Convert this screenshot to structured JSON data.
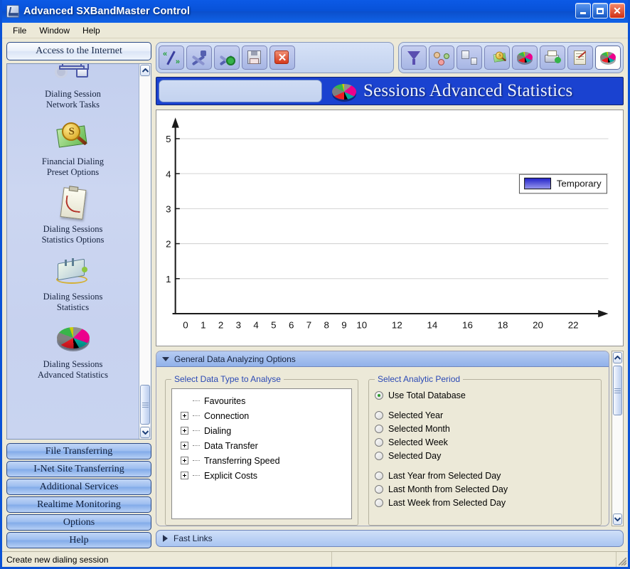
{
  "window": {
    "title": "Advanced SXBandMaster Control",
    "icon": "app-icon",
    "controls": {
      "minimize": "_",
      "maximize": "□",
      "close": "×"
    }
  },
  "menu": {
    "items": [
      "File",
      "Window",
      "Help"
    ]
  },
  "sidebar": {
    "access_button": "Access to the Internet",
    "items": [
      {
        "label_line1": "Dialing Session",
        "label_line2": "Network Tasks",
        "icon": "network-computers-icon"
      },
      {
        "label_line1": "Financial Dialing",
        "label_line2": "Preset Options",
        "icon": "money-magnifier-icon"
      },
      {
        "label_line1": "Dialing Sessions",
        "label_line2": "Statistics Options",
        "icon": "clipboard-chart-icon"
      },
      {
        "label_line1": "Dialing Sessions",
        "label_line2": "Statistics",
        "icon": "statistics-device-icon"
      },
      {
        "label_line1": "Dialing Sessions",
        "label_line2": "Advanced Statistics",
        "icon": "pie-chart-icon"
      }
    ],
    "buttons": [
      "File Transferring",
      "I-Net Site Transferring",
      "Additional Services",
      "Realtime Monitoring",
      "Options",
      "Help"
    ],
    "scrollbar": {
      "up": "scroll-up-arrow",
      "down": "scroll-down-arrow"
    }
  },
  "toolbar_left": [
    {
      "name": "quick-navigate-button",
      "icon": "double-arrow-icon"
    },
    {
      "name": "tools-button",
      "icon": "hammer-wrench-icon"
    },
    {
      "name": "settings-button",
      "icon": "tools-gear-icon"
    },
    {
      "name": "save-button",
      "icon": "floppy-disk-icon"
    },
    {
      "name": "close-button",
      "icon": "red-x-icon"
    }
  ],
  "toolbar_right": [
    {
      "name": "filter-button",
      "icon": "funnel-icon",
      "selected": false
    },
    {
      "name": "accounts-button",
      "icon": "people-icon",
      "selected": false
    },
    {
      "name": "devices-button",
      "icon": "devices-icon",
      "selected": false
    },
    {
      "name": "financial-button",
      "icon": "money-magnifier-icon",
      "selected": false
    },
    {
      "name": "statistics-button",
      "icon": "pie-chart-icon",
      "selected": false
    },
    {
      "name": "reports-button",
      "icon": "printer-icon",
      "selected": false
    },
    {
      "name": "notes-button",
      "icon": "note-pen-icon",
      "selected": false
    },
    {
      "name": "advanced-statistics-button",
      "icon": "pie-chart-icon",
      "selected": true
    }
  ],
  "banner": {
    "input_value": "",
    "input_placeholder": "",
    "icon": "pie-chart-icon",
    "title": "Sessions Advanced Statistics"
  },
  "chart_data": {
    "type": "bar",
    "title": "",
    "xlabel": "",
    "ylabel": "",
    "x_ticks": [
      "0",
      "1",
      "2",
      "3",
      "4",
      "5",
      "6",
      "7",
      "8",
      "9",
      "10",
      "12",
      "14",
      "16",
      "18",
      "20",
      "22"
    ],
    "y_ticks": [
      "1",
      "2",
      "3",
      "4",
      "5"
    ],
    "xlim": [
      0,
      23
    ],
    "ylim": [
      0,
      5.6
    ],
    "grid": true,
    "categories": [
      "0",
      "1",
      "2",
      "3",
      "4",
      "5",
      "6",
      "7",
      "8",
      "9",
      "10",
      "12",
      "14",
      "16",
      "18",
      "20",
      "22"
    ],
    "values": [
      0,
      0,
      0,
      0,
      0,
      0,
      0,
      0,
      0,
      0,
      0,
      0,
      0,
      0,
      0,
      0,
      0
    ],
    "series": [
      {
        "name": "Temporary",
        "color": "#3b3bdb",
        "values": [
          0,
          0,
          0,
          0,
          0,
          0,
          0,
          0,
          0,
          0,
          0,
          0,
          0,
          0,
          0,
          0,
          0
        ]
      }
    ],
    "legend": {
      "position": "right",
      "entries": [
        {
          "label": "Temporary",
          "color": "#3b3bdb"
        }
      ]
    }
  },
  "options_panel": {
    "header": "General Data Analyzing Options",
    "header_state": "expanded",
    "data_type_group": {
      "legend": "Select Data Type to Analyse",
      "items": [
        {
          "label": "Favourites",
          "expandable": false
        },
        {
          "label": "Connection",
          "expandable": true
        },
        {
          "label": "Dialing",
          "expandable": true
        },
        {
          "label": "Data Transfer",
          "expandable": true
        },
        {
          "label": "Transferring Speed",
          "expandable": true
        },
        {
          "label": "Explicit Costs",
          "expandable": true
        }
      ]
    },
    "period_group": {
      "legend": "Select Analytic Period",
      "options": [
        {
          "label": "Use Total Database",
          "selected": true,
          "gap_after": true
        },
        {
          "label": "Selected Year",
          "selected": false
        },
        {
          "label": "Selected Month",
          "selected": false
        },
        {
          "label": "Selected Week",
          "selected": false
        },
        {
          "label": "Selected Day",
          "selected": false,
          "gap_after": true
        },
        {
          "label": "Last Year from Selected Day",
          "selected": false
        },
        {
          "label": "Last Month from Selected Day",
          "selected": false
        },
        {
          "label": "Last Week from Selected Day",
          "selected": false
        }
      ]
    }
  },
  "fast_links": {
    "label": "Fast Links",
    "state": "collapsed"
  },
  "status_bar": {
    "text": "Create new dialing session"
  },
  "colors": {
    "titlebar_blue": "#0a52d6",
    "banner_blue": "#1a42d0",
    "panel_beige": "#ece9d8",
    "sidebar_blue": "#c9d4ef",
    "legend_series": "#3b3bdb",
    "accent_green": "#2d9b2d",
    "group_legend_text": "#2b49b5"
  }
}
